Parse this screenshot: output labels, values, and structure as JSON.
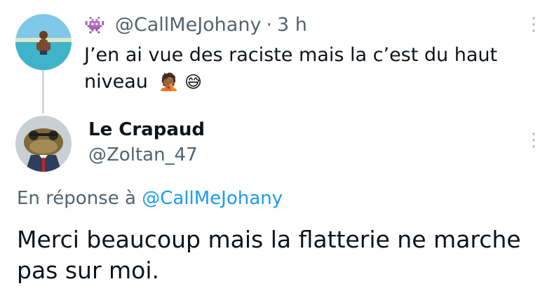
{
  "parent_tweet": {
    "badge_emoji": "👾",
    "handle": "@CallMeJohany",
    "separator": "·",
    "time": "3 h",
    "text": "J’en ai vue des raciste mais la c’est du haut niveau",
    "emojis": "🤦🏾 😅"
  },
  "reply_tweet": {
    "display_name": "Le Crapaud",
    "handle": "@Zoltan_47",
    "reply_prefix": "En réponse à",
    "reply_to_handle": "@CallMeJohany",
    "text": "Merci beaucoup mais la flatterie ne marche pas sur moi."
  },
  "colors": {
    "link": "#1d9bf0",
    "secondary_text": "#536471",
    "thread_line": "#cfd9de"
  },
  "icons": {
    "more": "more-vertical-icon"
  }
}
